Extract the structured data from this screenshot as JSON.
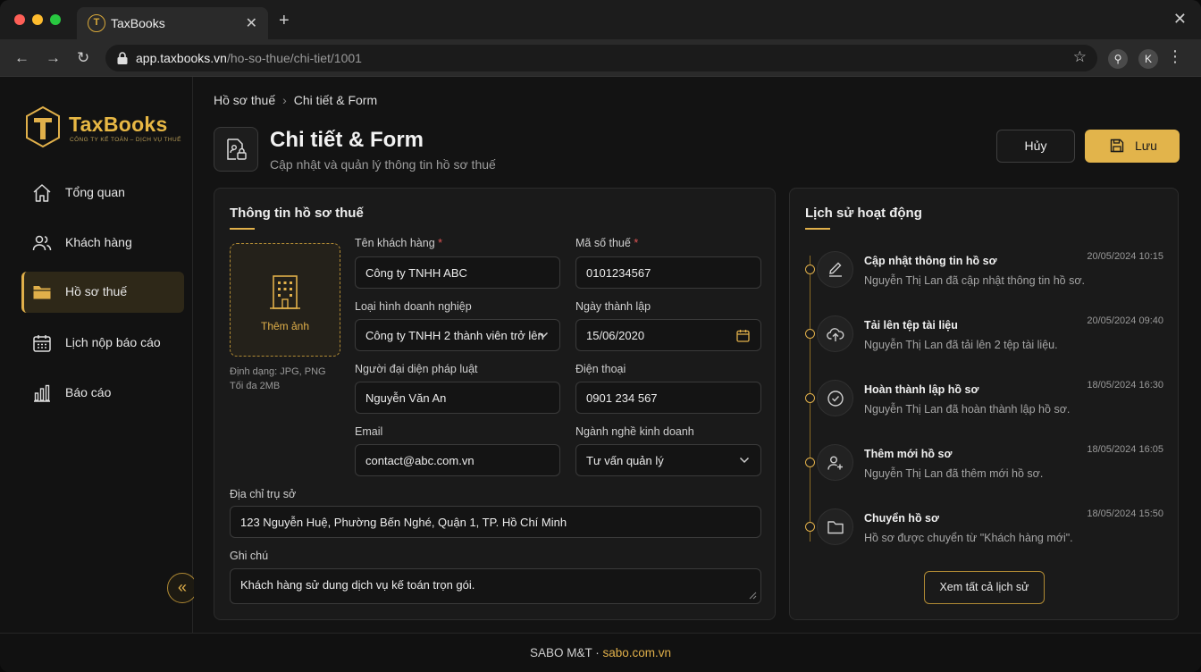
{
  "browser": {
    "tab_title": "TaxBooks",
    "url_host": "app.taxbooks.vn",
    "url_path": "/ho-so-thue/chi-tiet/1001",
    "profile_initial": "K"
  },
  "sidebar": {
    "brand_name": "TaxBooks",
    "brand_tagline": "CÔNG TY KẾ TOÁN – DỊCH VỤ THUẾ",
    "items": [
      {
        "label": "Tổng quan",
        "icon": "home-icon",
        "active": false
      },
      {
        "label": "Khách hàng",
        "icon": "users-icon",
        "active": false
      },
      {
        "label": "Hồ sơ thuế",
        "icon": "folder-icon",
        "active": true
      },
      {
        "label": "Lịch nộp báo cáo",
        "icon": "calendar-icon",
        "active": false
      },
      {
        "label": "Báo cáo",
        "icon": "bar-chart-icon",
        "active": false
      }
    ],
    "collapse_glyph": "«"
  },
  "header": {
    "breadcrumb": [
      "Hồ sơ thuế",
      "Chi tiết & Form"
    ],
    "title": "Chi tiết & Form",
    "subtitle": "Cập nhật và quản lý thông tin hồ sơ thuế",
    "cancel_label": "Hủy",
    "save_label": "Lưu"
  },
  "form": {
    "title": "Thông tin hồ sơ thuế",
    "upload_label": "Thêm ảnh",
    "upload_hint_format": "Định dạng: JPG, PNG",
    "upload_hint_size": "Tối đa 2MB",
    "customer_name": {
      "label": "Tên khách hàng",
      "value": "Công ty TNHH ABC"
    },
    "tax_code": {
      "label": "Mã số thuế",
      "value": "0101234567"
    },
    "business_type": {
      "label": "Loại hình doanh nghiệp",
      "value": "Công ty TNHH 2 thành viên trở lên"
    },
    "founded_date": {
      "label": "Ngày thành lập",
      "value": "15/06/2020"
    },
    "legal_rep": {
      "label": "Người đại diện pháp luật",
      "value": "Nguyễn Văn An"
    },
    "phone": {
      "label": "Điện thoại",
      "value": "0901 234 567"
    },
    "email": {
      "label": "Email",
      "value": "contact@abc.com.vn"
    },
    "industry": {
      "label": "Ngành nghề kinh doanh",
      "value": "Tư vấn quản lý"
    },
    "address": {
      "label": "Địa chỉ trụ sở",
      "value": "123 Nguyễn Huệ, Phường Bến Nghé, Quận 1, TP. Hồ Chí Minh"
    },
    "note": {
      "label": "Ghi chú",
      "value": "Khách hàng sử dung dịch vụ kế toán trọn gói."
    },
    "required_mark": "*"
  },
  "history": {
    "title": "Lịch sử hoạt động",
    "items": [
      {
        "title": "Cập nhật thông tin hồ sơ",
        "desc": "Nguyễn Thị Lan đã cập nhật thông tin hồ sơ.",
        "time": "20/05/2024 10:15",
        "icon": "edit-icon"
      },
      {
        "title": "Tải lên tệp tài liệu",
        "desc": "Nguyễn Thị Lan đã tải lên 2 tệp tài liệu.",
        "time": "20/05/2024 09:40",
        "icon": "cloud-upload-icon"
      },
      {
        "title": "Hoàn thành lập hồ sơ",
        "desc": "Nguyễn Thị Lan đã hoàn thành lập hồ sơ.",
        "time": "18/05/2024 16:30",
        "icon": "check-circle-icon"
      },
      {
        "title": "Thêm mới hồ sơ",
        "desc": "Nguyễn Thị Lan đã thêm mới hồ sơ.",
        "time": "18/05/2024 16:05",
        "icon": "user-plus-icon"
      },
      {
        "title": "Chuyển hồ sơ",
        "desc": "Hồ sơ được chuyển từ \"Khách hàng mới\".",
        "time": "18/05/2024 15:50",
        "icon": "folder-icon"
      }
    ],
    "view_all_label": "Xem tất cả lịch sử"
  },
  "footer": {
    "company": "SABO M&T",
    "separator": "·",
    "site": "sabo.com.vn"
  },
  "colors": {
    "accent": "#e1b04a",
    "background": "#131313",
    "card": "#1a1a1a",
    "required": "#e05555"
  }
}
